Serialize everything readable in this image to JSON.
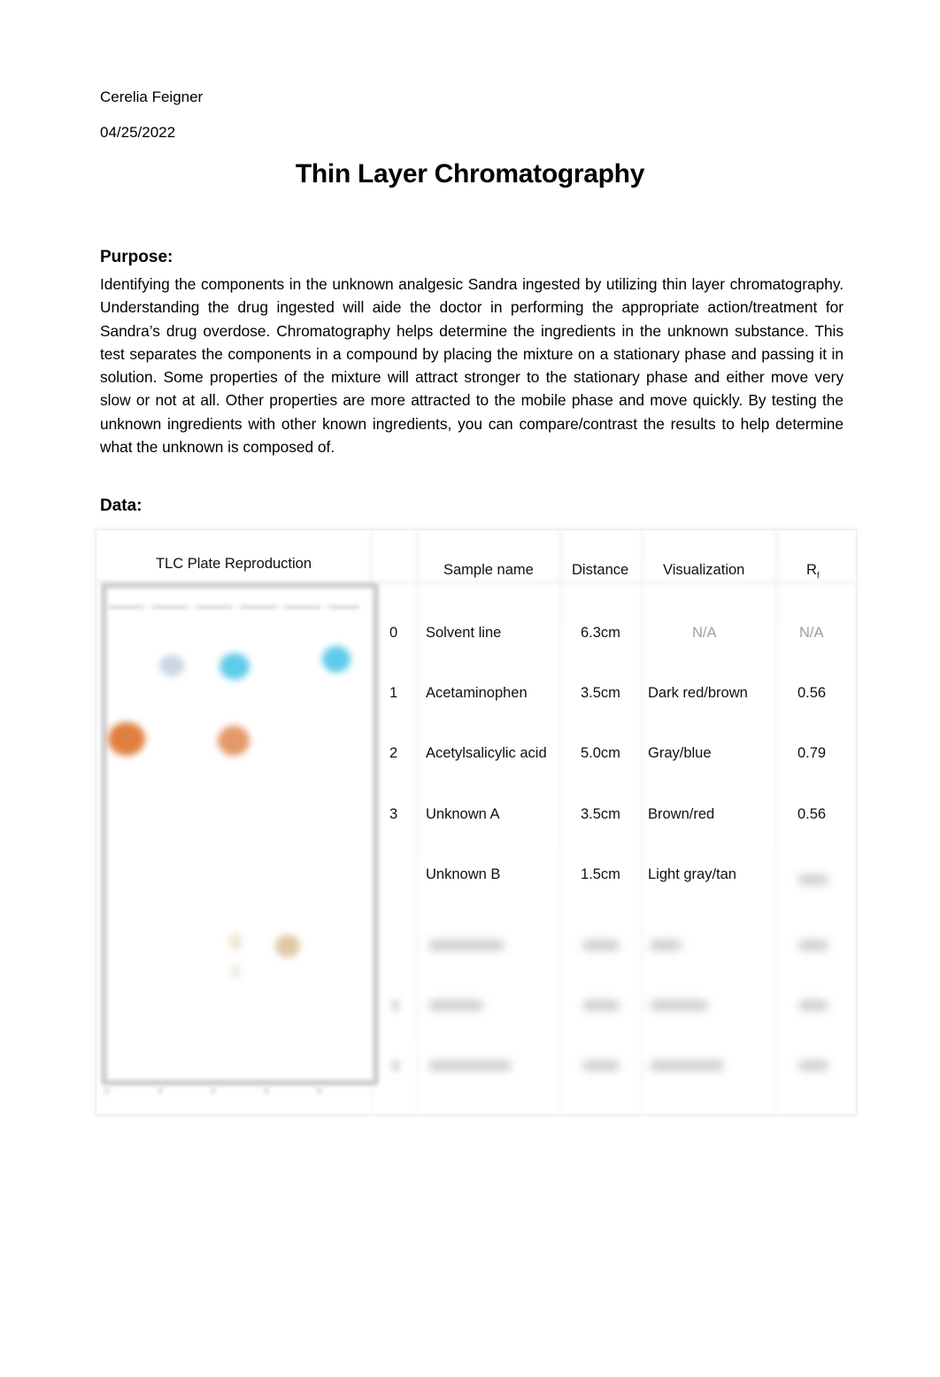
{
  "document": {
    "author": "Cerelia Feigner",
    "date": "04/25/2022",
    "title": "Thin Layer Chromatography"
  },
  "purpose": {
    "heading": "Purpose:",
    "text": "Identifying the components in the unknown analgesic Sandra ingested by utilizing thin layer chromatography. Understanding the drug ingested will aide the doctor in performing the appropriate action/treatment for Sandra’s drug overdose. Chromatography helps determine the ingredients in the unknown substance. This test separates the components in a compound by placing the mixture on a stationary phase and passing it in solution.  Some properties of the mixture will attract stronger to the stationary phase and either move very slow or not at all.  Other properties are more attracted to the mobile phase and move quickly. By testing the unknown ingredients with other known ingredients, you can compare/contrast the results to help determine what the unknown is composed of."
  },
  "data_section": {
    "heading": "Data:",
    "plate": {
      "caption": "TLC Plate Reproduction",
      "spot_colors": {
        "gray_blue": "#c9d6e3",
        "blue": "#5fcbea",
        "orange": "#e07f3e",
        "orange_light": "#e39a68",
        "tan": "#e2c8a6",
        "pale": "#efe6d3"
      }
    },
    "table": {
      "headers": {
        "index": "",
        "sample": "Sample name",
        "distance": "Distance",
        "visualization": "Visualization",
        "rf_main": "R",
        "rf_sub": "f"
      },
      "rows": [
        {
          "index": "0",
          "sample": "Solvent line",
          "distance": "6.3cm",
          "visualization": "N/A",
          "rf": "N/A"
        },
        {
          "index": "1",
          "sample": "Acetaminophen",
          "distance": "3.5cm",
          "visualization": "Dark red/brown",
          "rf": "0.56"
        },
        {
          "index": "2",
          "sample": "Acetylsalicylic acid",
          "distance": "5.0cm",
          "visualization": "Gray/blue",
          "rf": "0.79"
        },
        {
          "index": "3",
          "sample": "Unknown A",
          "distance": "3.5cm",
          "visualization": "Brown/red",
          "rf": "0.56"
        },
        {
          "index": "",
          "sample": "Unknown B",
          "distance": "1.5cm",
          "visualization": "Light gray/tan",
          "rf": ""
        }
      ],
      "blurred_rows_count": 3
    }
  }
}
